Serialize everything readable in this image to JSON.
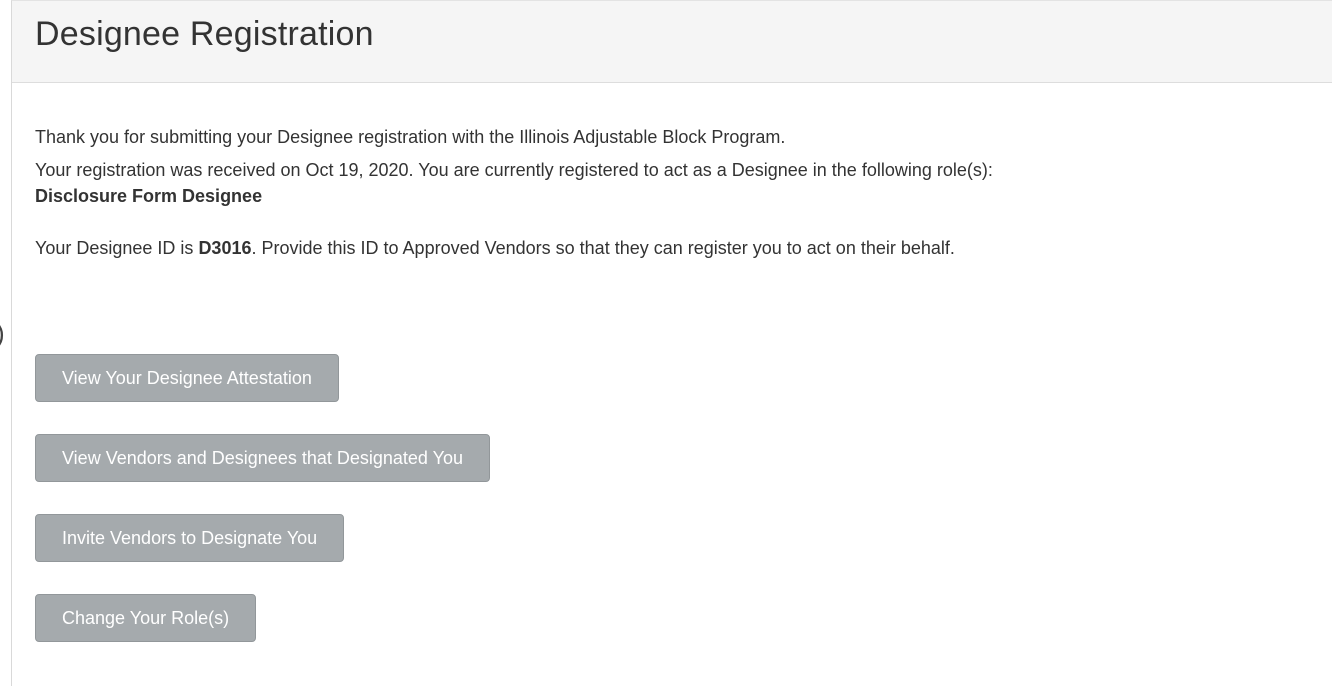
{
  "page_title": "Designee Registration",
  "thank_you_text": "Thank you for submitting your Designee registration with the Illinois Adjustable Block Program.",
  "received_text": "Your registration was received on Oct 19, 2020. You are currently registered to act as a Designee in the following role(s):",
  "role_name": "Disclosure Form Designee",
  "designee_id_prefix": "Your Designee ID is ",
  "designee_id": "D3016",
  "designee_id_suffix": ". Provide this ID to Approved Vendors so that they can register you to act on their behalf.",
  "edge_glyph": ")",
  "buttons": {
    "view_attestation": "View Your Designee Attestation",
    "view_vendors": "View Vendors and Designees that Designated You",
    "invite_vendors": "Invite Vendors to Designate You",
    "change_roles": "Change Your Role(s)"
  },
  "colors": {
    "button_background": "#a5aaad",
    "header_background": "#f5f5f5",
    "text": "#333333"
  }
}
